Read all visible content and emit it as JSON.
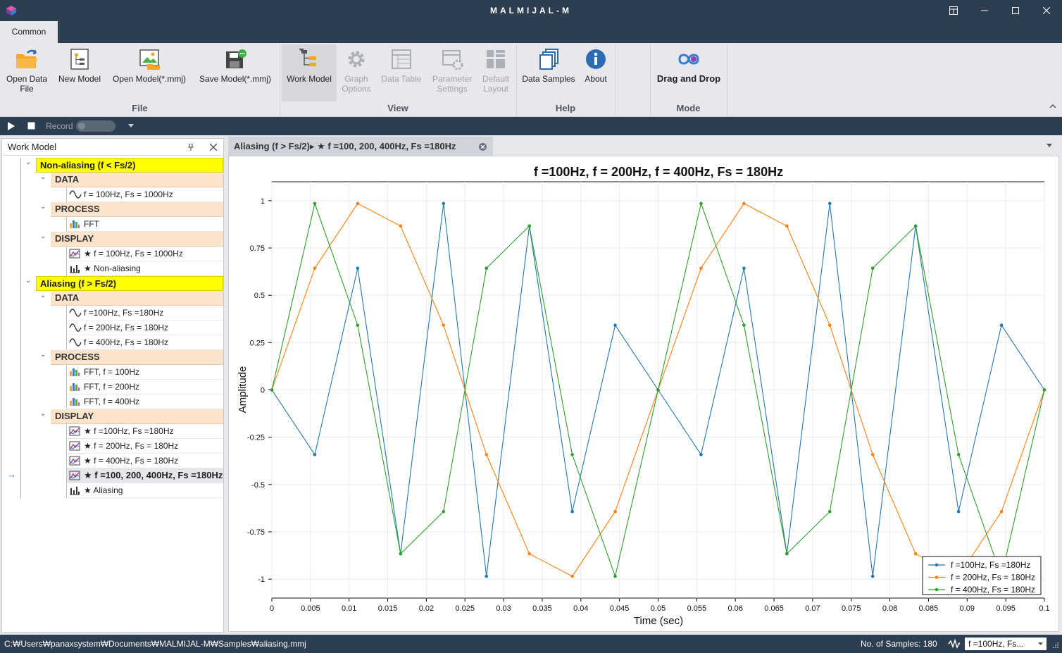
{
  "window": {
    "title": "MALMIJAL-M"
  },
  "ribbon": {
    "tab": "Common",
    "buttons": {
      "open_data_file": "Open Data\nFile",
      "new_model": "New Model",
      "open_model": "Open Model(*.mmj)",
      "save_model": "Save Model(*.mmj)",
      "work_model": "Work Model",
      "graph_options": "Graph\nOptions",
      "data_table": "Data Table",
      "parameter_settings": "Parameter\nSettings",
      "default_layout": "Default\nLayout",
      "data_samples": "Data Samples",
      "about": "About",
      "drag_and_drop": "Drag and Drop"
    },
    "groups": {
      "file": "File",
      "view": "View",
      "help": "Help",
      "mode": "Mode"
    }
  },
  "playbar": {
    "record": "Record"
  },
  "work_model": {
    "title": "Work Model",
    "groups": [
      {
        "label": "Non-aliasing (f < Fs/2)",
        "sections": [
          {
            "label": "DATA",
            "items": [
              "f = 100Hz, Fs = 1000Hz"
            ]
          },
          {
            "label": "PROCESS",
            "items": [
              "FFT"
            ]
          },
          {
            "label": "DISPLAY",
            "items": [
              "★ f = 100Hz, Fs = 1000Hz",
              "★ Non-aliasing"
            ]
          }
        ]
      },
      {
        "label": "Aliasing (f > Fs/2)",
        "sections": [
          {
            "label": "DATA",
            "items": [
              "f  =100Hz, Fs =180Hz",
              "f = 200Hz, Fs = 180Hz",
              "f = 400Hz, Fs = 180Hz"
            ]
          },
          {
            "label": "PROCESS",
            "items": [
              "FFT, f = 100Hz",
              "FFT, f = 200Hz",
              "FFT, f = 400Hz"
            ]
          },
          {
            "label": "DISPLAY",
            "items": [
              "★ f  =100Hz, Fs =180Hz",
              "★ f = 200Hz, Fs = 180Hz",
              "★ f = 400Hz, Fs = 180Hz",
              "★ f  =100, 200, 400Hz, Fs =180Hz",
              "★ Aliasing"
            ]
          }
        ]
      }
    ]
  },
  "doc_tab": {
    "label": "Aliasing (f > Fs/2)▸ ★ f  =100, 200, 400Hz, Fs =180Hz"
  },
  "status": {
    "path": "C:₩Users₩panaxsystem₩Documents₩MALMIJAL-M₩Samples₩aliasing.mmj",
    "samples": "No. of Samples: 180",
    "dropdown": "f  =100Hz, Fs..."
  },
  "chart_data": {
    "type": "line",
    "title": "f  =100Hz,  f = 200Hz, f = 400Hz, Fs = 180Hz",
    "xlabel": "Time (sec)",
    "ylabel": "Amplitude",
    "xlim": [
      0,
      0.1
    ],
    "ylim": [
      -1.1,
      1.1
    ],
    "x_ticks": [
      "0",
      "0.005",
      "0.01",
      "0.015",
      "0.02",
      "0.025",
      "0.03",
      "0.035",
      "0.04",
      "0.045",
      "0.05",
      "0.055",
      "0.06",
      "0.065",
      "0.07",
      "0.075",
      "0.08",
      "0.085",
      "0.09",
      "0.095",
      "0.1"
    ],
    "y_ticks": [
      "1",
      "0.75",
      "0.5",
      "0.25",
      "0",
      "-0.25",
      "-0.5",
      "-0.75",
      "-1"
    ],
    "grid": true,
    "legend_position": "bottom-right",
    "x": [
      0,
      0.005556,
      0.011111,
      0.016667,
      0.022222,
      0.027778,
      0.033333,
      0.038889,
      0.044444,
      0.05,
      0.055556,
      0.061111,
      0.066667,
      0.072222,
      0.077778,
      0.083333,
      0.088889,
      0.094444,
      0.1
    ],
    "series": [
      {
        "name": "f  =100Hz, Fs =180Hz",
        "color": "#1f77b4",
        "values": [
          0,
          -0.342,
          0.643,
          -0.866,
          0.985,
          -0.985,
          0.866,
          -0.643,
          0.342,
          0,
          -0.342,
          0.643,
          -0.866,
          0.985,
          -0.985,
          0.866,
          -0.643,
          0.342,
          0
        ]
      },
      {
        "name": "f = 200Hz, Fs = 180Hz",
        "color": "#ff7f0e",
        "values": [
          0,
          0.643,
          0.985,
          0.866,
          0.342,
          -0.342,
          -0.866,
          -0.985,
          -0.643,
          0,
          0.643,
          0.985,
          0.866,
          0.342,
          -0.342,
          -0.866,
          -0.985,
          -0.643,
          0
        ]
      },
      {
        "name": "f = 400Hz, Fs = 180Hz",
        "color": "#2ca02c",
        "values": [
          0,
          0.985,
          0.342,
          -0.866,
          -0.643,
          0.643,
          0.866,
          -0.342,
          -0.985,
          0,
          0.985,
          0.342,
          -0.866,
          -0.643,
          0.643,
          0.866,
          -0.342,
          -0.985,
          0
        ]
      }
    ]
  }
}
